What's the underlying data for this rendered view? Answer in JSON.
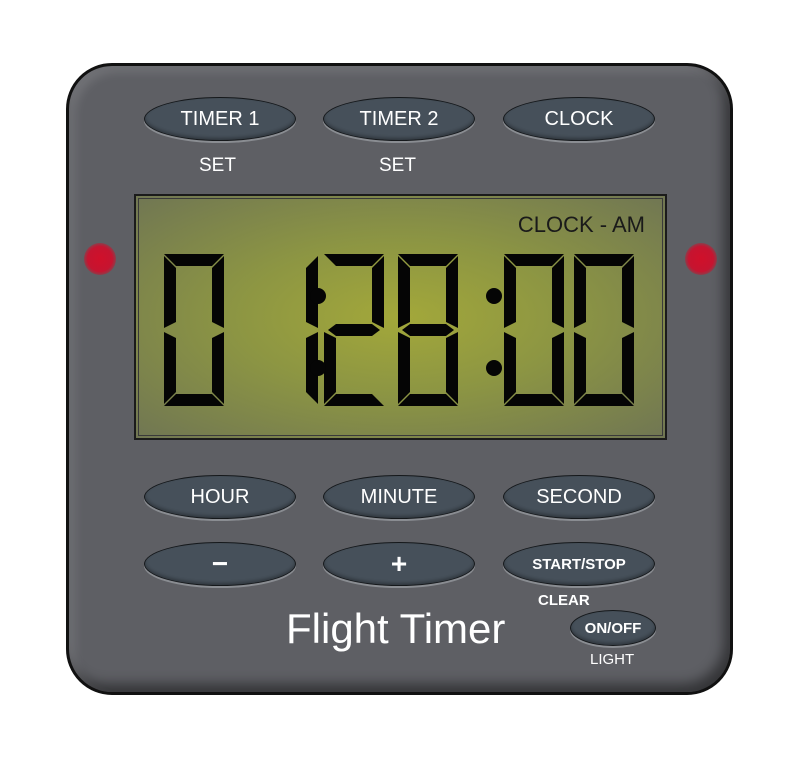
{
  "device": {
    "title": "Flight Timer",
    "led_color": "#c51430",
    "body_color": "#5e5f64"
  },
  "top_buttons": [
    {
      "label": "TIMER 1",
      "sublabel": "SET"
    },
    {
      "label": "TIMER 2",
      "sublabel": "SET"
    },
    {
      "label": "CLOCK",
      "sublabel": ""
    }
  ],
  "display": {
    "mode": "CLOCK - AM",
    "time": "01:28:00",
    "digits": [
      "0",
      "1",
      "2",
      "8",
      "0",
      "0"
    ]
  },
  "set_buttons": [
    {
      "label": "HOUR"
    },
    {
      "label": "MINUTE"
    },
    {
      "label": "SECOND"
    }
  ],
  "control_buttons": [
    {
      "label": "−",
      "icon": "minus-icon"
    },
    {
      "label": "+",
      "icon": "plus-icon"
    },
    {
      "label": "START/STOP",
      "sublabel": "CLEAR"
    }
  ],
  "light_button": {
    "label": "ON/OFF",
    "sublabel": "LIGHT"
  }
}
